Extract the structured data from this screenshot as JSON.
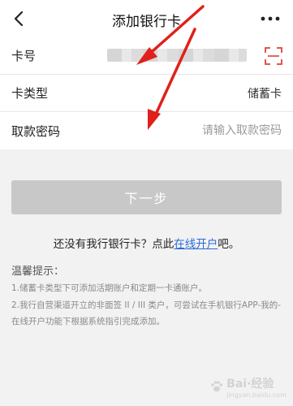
{
  "header": {
    "title": "添加银行卡",
    "back_icon": "chevron-left-icon",
    "more_icon": "more-horizontal-icon"
  },
  "form": {
    "card_number": {
      "label": "卡号",
      "scan_icon": "scan-card-icon"
    },
    "card_type": {
      "label": "卡类型",
      "value": "储蓄卡"
    },
    "withdraw_password": {
      "label": "取款密码",
      "placeholder": "请输入取款密码"
    }
  },
  "actions": {
    "next_label": "下一步"
  },
  "open_account": {
    "prefix": "还没有我行银行卡？点此",
    "link": "在线开户",
    "suffix": "吧。"
  },
  "tips": {
    "title": "温馨提示：",
    "items": [
      "1.储蓄卡类型下可添加活期账户和定期一卡通账户。",
      "2.我行自营渠道开立的非面签 II / III 类户，可尝试在手机银行APP-我的-在线开户功能下根据系统指引完成添加。"
    ]
  },
  "colors": {
    "link": "#2a6ad6",
    "button_disabled": "#c8c8c8",
    "annotation_arrow": "#e0201a",
    "scan_icon": "#e0403a"
  }
}
